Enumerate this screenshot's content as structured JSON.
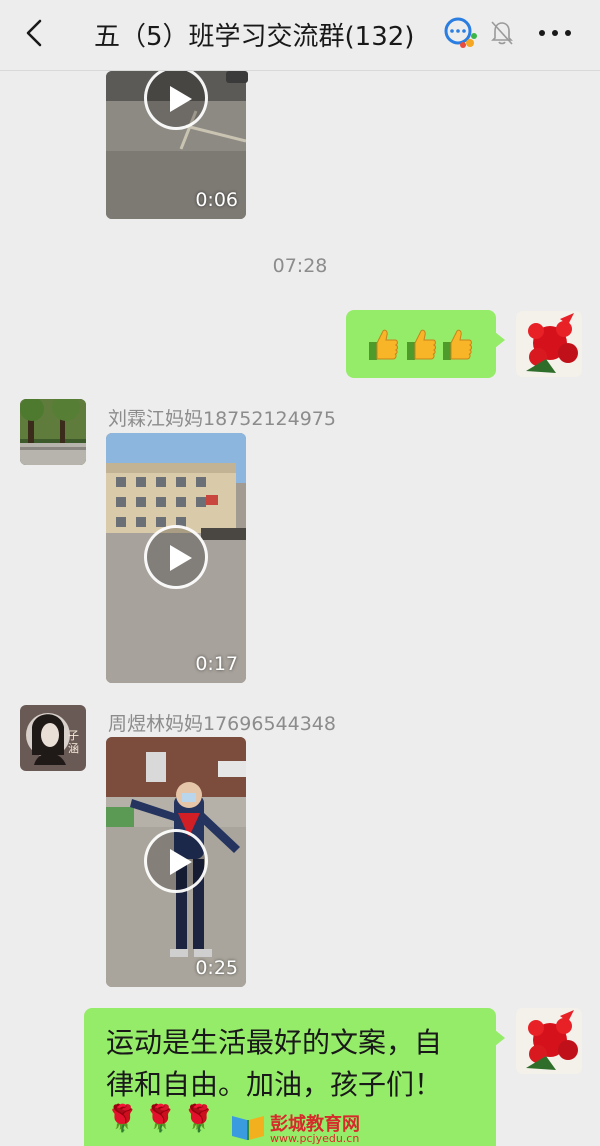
{
  "header": {
    "title": "五（5）班学习交流群(132)"
  },
  "messages": {
    "video1": {
      "duration": "0:06"
    },
    "timestamp": "07:28",
    "reaction": {
      "emoji": "👍👍👍"
    },
    "video2": {
      "sender": "刘霖江妈妈18752124975",
      "duration": "0:17"
    },
    "video3": {
      "sender": "周煜林妈妈17696544348",
      "duration": "0:25"
    },
    "text_message": {
      "text": "运动是生活最好的文案，自律和自由。加油，孩子们！",
      "emoji": "🌹🌹🌹"
    }
  },
  "avatar3": {
    "signature": "子涵"
  },
  "watermark": {
    "name": "彭城教育网",
    "url": "www.pcjyedu.cn"
  },
  "colors": {
    "bubble": "#95ec69",
    "background": "#ededed",
    "watermark": "#d62b2b"
  }
}
